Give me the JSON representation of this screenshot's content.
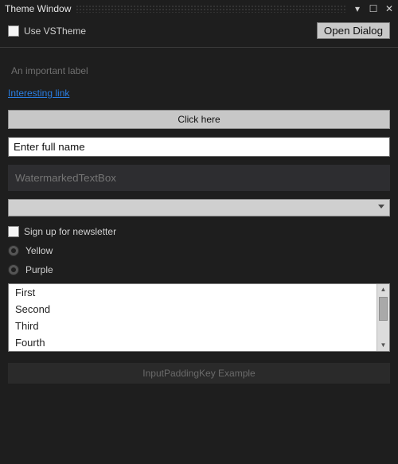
{
  "titlebar": {
    "title": "Theme Window"
  },
  "toprow": {
    "use_vstheme_label": "Use VSTheme",
    "open_dialog_label": "Open Dialog"
  },
  "content": {
    "important_label": "An important label",
    "link_text": "Interesting link",
    "click_button_label": "Click here",
    "fullname_value": "Enter full name",
    "watermark_placeholder": "WatermarkedTextBox",
    "newsletter_label": "Sign up for newsletter",
    "radio_yellow": "Yellow",
    "radio_purple": "Purple",
    "list": {
      "items": [
        "First",
        "Second",
        "Third",
        "Fourth"
      ]
    },
    "padding_example_label": "InputPaddingKey Example"
  }
}
